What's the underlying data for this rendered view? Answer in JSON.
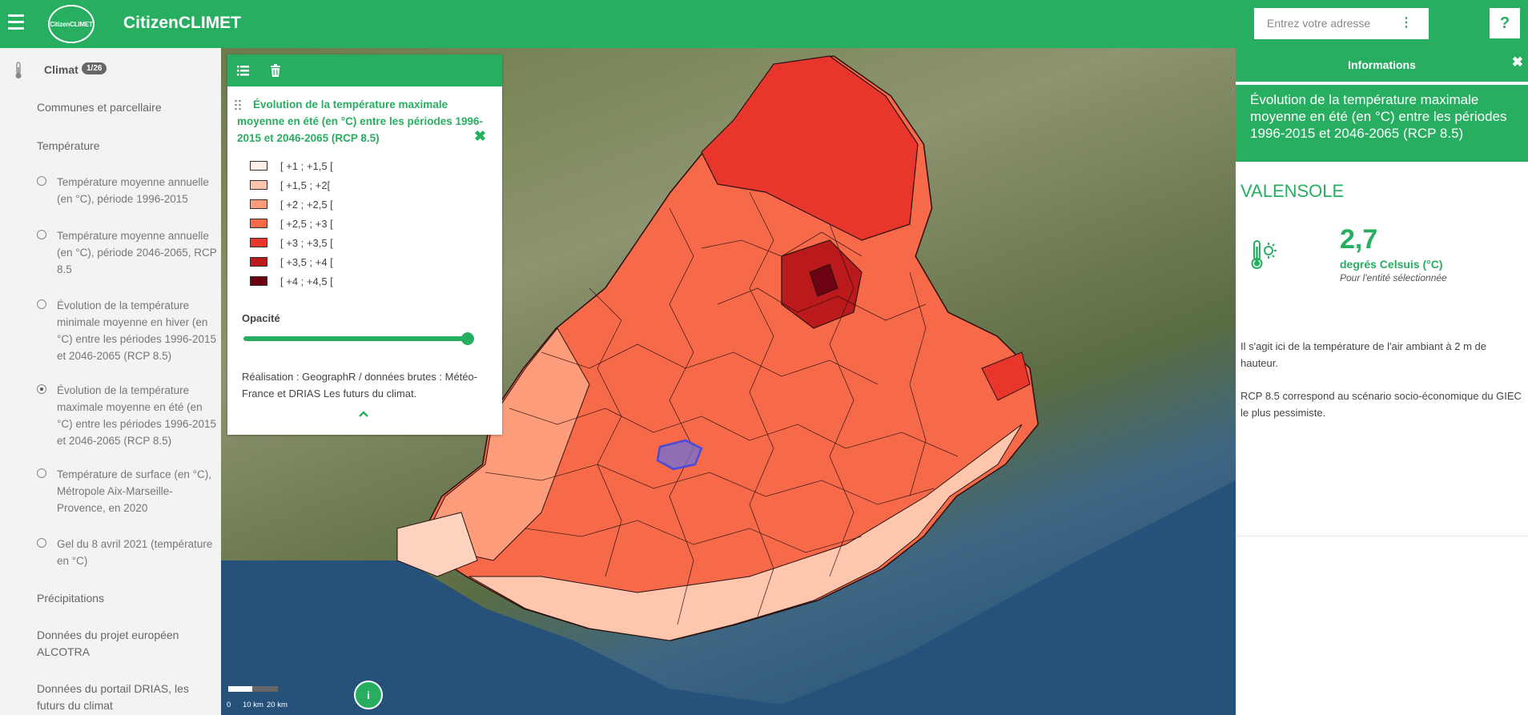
{
  "header": {
    "app_title": "CitizenCLIMET",
    "logo_text": "CitizenCLIMET",
    "search_placeholder": "Entrez votre adresse",
    "help_label": "?"
  },
  "sidebar": {
    "section_label": "Climat",
    "section_count": "1/26",
    "items": [
      "Communes et parcellaire",
      "Température",
      "Précipitations",
      "Données du projet européen ALCOTRA",
      "Données du portail DRIAS, les futurs du climat"
    ],
    "layers": [
      {
        "label": "Température moyenne annuelle (en °C), période 1996-2015",
        "selected": false
      },
      {
        "label": "Température moyenne annuelle (en °C), période 2046-2065, RCP 8.5",
        "selected": false
      },
      {
        "label": "Évolution de la température minimale moyenne en hiver (en °C) entre les périodes 1996-2015 et 2046-2065 (RCP 8.5)",
        "selected": false
      },
      {
        "label": "Évolution de la température maximale moyenne en été (en °C) entre les périodes 1996-2015 et 2046-2065 (RCP 8.5)",
        "selected": true
      },
      {
        "label": "Température de surface (en °C), Métropole Aix-Marseille-Provence, en 2020",
        "selected": false
      },
      {
        "label": "Gel du 8 avril 2021 (température en °C)",
        "selected": false
      }
    ]
  },
  "legend": {
    "title": "Évolution de la température maximale moyenne en été (en °C) entre les périodes 1996-2015 et 2046-2065 (RCP 8.5)",
    "classes": [
      {
        "label": "[ +1 ; +1,5 [",
        "color": "#fff1ea"
      },
      {
        "label": "[ +1,5 ; +2[",
        "color": "#fdc6ad"
      },
      {
        "label": "[ +2 ; +2,5 [",
        "color": "#fc9c7b"
      },
      {
        "label": "[ +2,5 ; +3 [",
        "color": "#f66a4a"
      },
      {
        "label": "[ +3 ; +3,5 [",
        "color": "#e8362c"
      },
      {
        "label": "[ +3,5 ; +4 [",
        "color": "#bb1a1d"
      },
      {
        "label": "[ +4 ; +4,5 [",
        "color": "#6b0313"
      }
    ],
    "opacity_label": "Opacité",
    "opacity_value": 1.0,
    "credit": "Réalisation : GeographR / données brutes : Météo-France et DRIAS Les futurs du climat."
  },
  "scale": {
    "zero": "0",
    "mid": "10 km",
    "end": "20 km"
  },
  "info_button_label": "i",
  "info_panel": {
    "header": "Informations",
    "layer_title": "Évolution de la température maximale moyenne en été (en °C) entre les périodes 1996-2015 et 2046-2065 (RCP 8.5)",
    "place": "VALENSOLE",
    "value": "2,7",
    "unit": "degrés Celsuis (°C)",
    "subtitle": "Pour l'entité sélectionnée",
    "paragraph1": "Il s'agit ici de la température de l'air ambiant à 2 m de hauteur.",
    "paragraph2": "RCP 8.5 correspond au scénario socio-économique du GIEC le plus pessimiste."
  },
  "colors": {
    "brand_green": "#27ae60",
    "selection": "#6f6fd8"
  }
}
